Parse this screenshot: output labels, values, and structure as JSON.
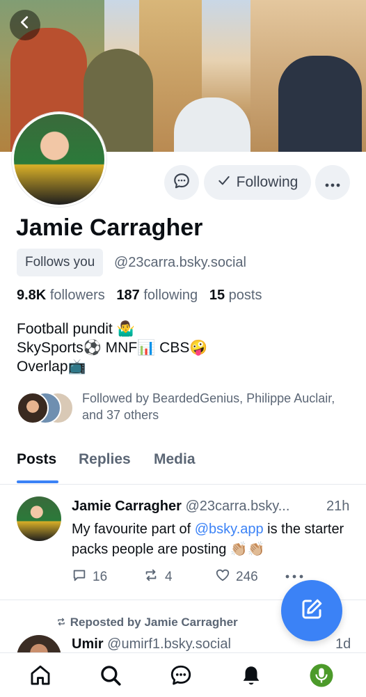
{
  "profile": {
    "name": "Jamie Carragher",
    "follows_you": "Follows you",
    "handle": "@23carra.bsky.social",
    "followers_count": "9.8K",
    "followers_label": "followers",
    "following_count": "187",
    "following_label": "following",
    "posts_count": "15",
    "posts_label": "posts",
    "bio_lines": [
      "Football pundit 🤷‍♂️",
      "SkySports⚽ MNF📊 CBS🤪",
      "Overlap📺"
    ],
    "followed_by_text": "Followed by BeardedGenius, Philippe Auclair, and 37 others"
  },
  "actions": {
    "following_label": "Following"
  },
  "tabs": [
    "Posts",
    "Replies",
    "Media"
  ],
  "post1": {
    "author": "Jamie Carragher",
    "handle": "@23carra.bsky...",
    "time": "21h",
    "text_before": "My favourite part of ",
    "link": "@bsky.app",
    "text_after": " is the starter packs people are posting 👏🏼👏🏼",
    "replies": "16",
    "reposts": "4",
    "likes": "246"
  },
  "post2": {
    "repost_label": "Reposted by Jamie Carragher",
    "author": "Umir",
    "handle": "@umirf1.bsky.social",
    "time": "1d"
  },
  "colors": {
    "accent": "#3b82f6",
    "muted": "#5b6675",
    "button_bg": "#eef1f5"
  },
  "icons": [
    "back-arrow-icon",
    "chat-bubble-icon",
    "checkmark-icon",
    "ellipsis-icon",
    "reply-icon",
    "repost-icon",
    "heart-icon",
    "compose-icon",
    "home-icon",
    "search-icon",
    "messages-icon",
    "bell-icon",
    "avatar-mic-icon"
  ]
}
